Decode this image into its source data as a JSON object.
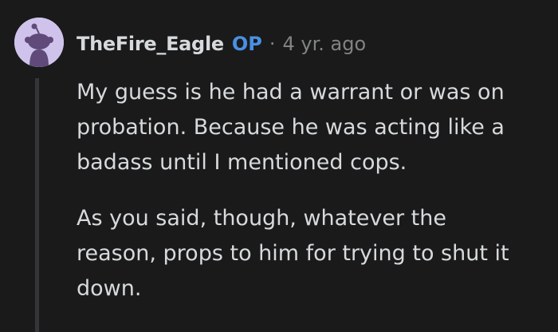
{
  "comment": {
    "author": "TheFire_Eagle",
    "badge": "OP",
    "separator": "·",
    "age": "4 yr. ago",
    "paragraphs": [
      "My guess is he had a warrant or was on\nprobation. Because he was acting like a\nbadass until I mentioned cops.",
      "As you said, though, whatever the\nreason, props to him for trying to shut it\ndown."
    ]
  },
  "colors": {
    "background": "#1a1a1b",
    "text": "#d7dadc",
    "muted": "#818384",
    "op_badge": "#4a90e2",
    "avatar_bg": "#cfc3ec",
    "avatar_figure": "#5f4a7a",
    "thread_line": "#343536"
  },
  "icons": {
    "avatar": "reddit-snoo-avatar-icon"
  }
}
